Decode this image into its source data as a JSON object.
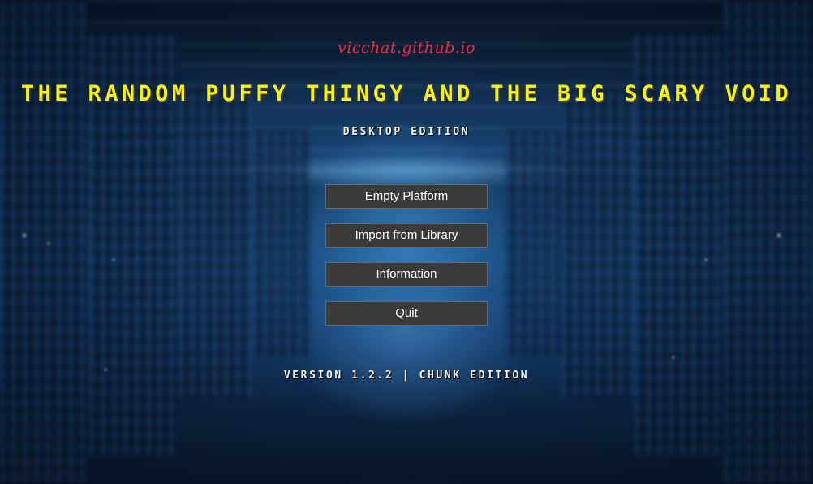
{
  "header": {
    "site_link": "vicchat.github.io",
    "title": "THE RANDOM PUFFY THINGY AND THE BIG SCARY VOID",
    "subtitle": "DESKTOP EDITION"
  },
  "menu": {
    "items": [
      {
        "label": "Empty Platform"
      },
      {
        "label": "Import from Library"
      },
      {
        "label": "Information"
      },
      {
        "label": "Quit"
      }
    ]
  },
  "footer": {
    "version": "VERSION 1.2.2 | CHUNK EDITION"
  },
  "colors": {
    "title": "#f4f01a",
    "site_link": "#d8324a",
    "button_bg": "#3b3b3b",
    "button_border": "#6a6a6a",
    "text_light": "#f2f2f2"
  }
}
